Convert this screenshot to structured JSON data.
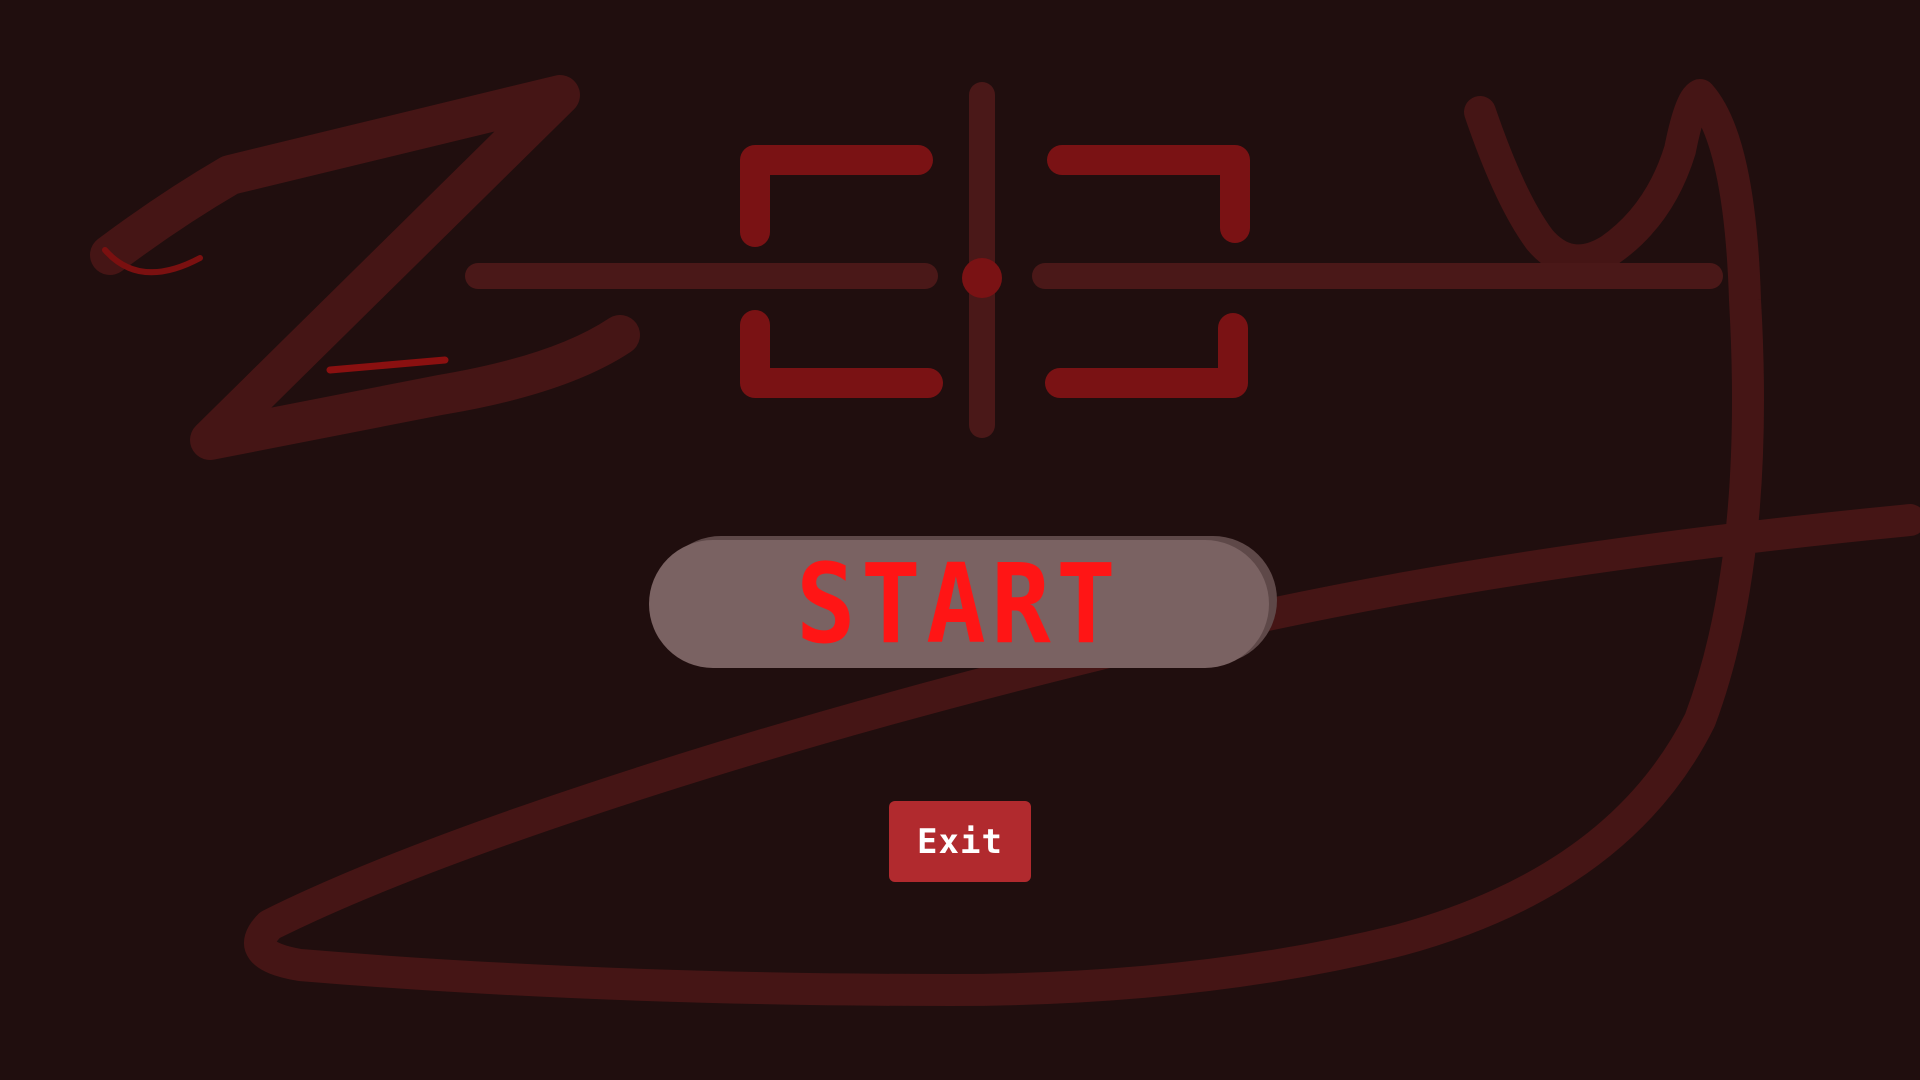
{
  "menu": {
    "start_label": "START",
    "exit_label": "Exit"
  },
  "logo": {
    "description_icon": "crosshair-icon"
  },
  "colors": {
    "background": "#200e0e",
    "scribble": "#451515",
    "crosshair_bracket": "#7a1214",
    "crosshair_line": "#4a1818",
    "start_bg": "#7a6262",
    "start_text": "#ff1515",
    "exit_bg": "#b12a2e",
    "exit_text": "#ffffff"
  }
}
